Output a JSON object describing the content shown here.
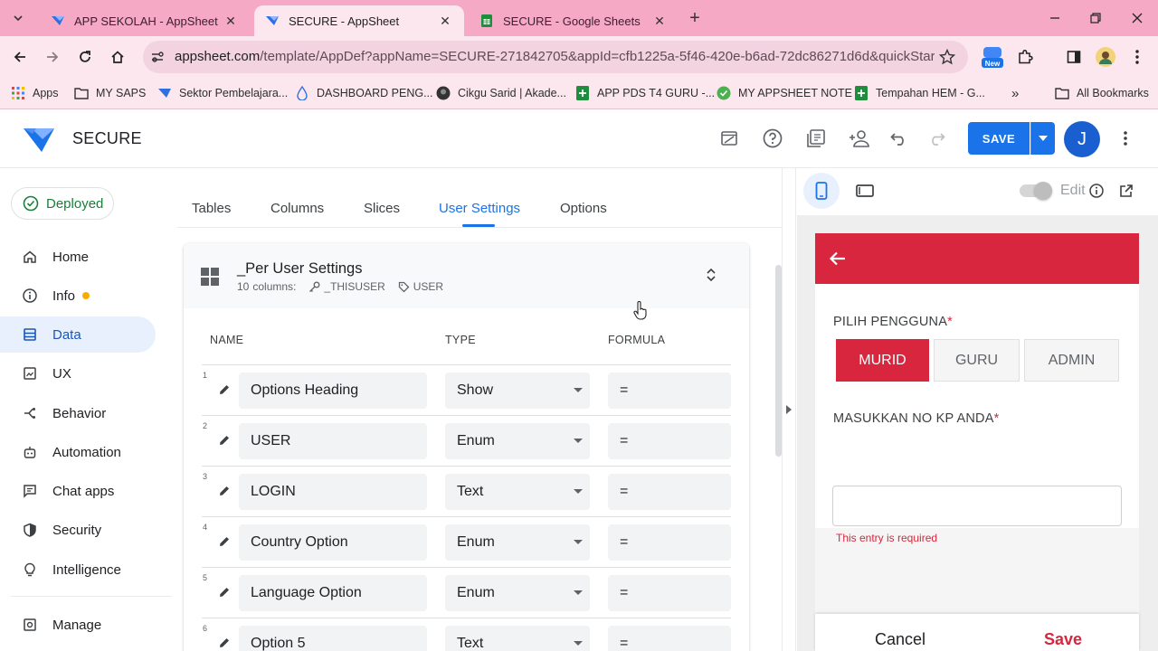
{
  "browser": {
    "tabs": [
      {
        "title": "APP SEKOLAH - AppSheet",
        "icon": "appsheet-icon"
      },
      {
        "title": "SECURE - AppSheet",
        "icon": "appsheet-icon"
      },
      {
        "title": "SECURE - Google Sheets",
        "icon": "google-sheets-icon"
      }
    ],
    "url_domain": "appsheet.com",
    "url_path": "/template/AppDef?appName=SECURE-271842705&appId=cfb1225a-5f46-420e-b6ad-72dc86271d6d&quickStart=False...",
    "new_badge": "New",
    "bookmarks": [
      {
        "label": "Apps",
        "icon": "apps-grid-icon"
      },
      {
        "label": "MY SAPS",
        "icon": "folder-icon"
      },
      {
        "label": "Sektor Pembelajara...",
        "icon": "appsheet-icon"
      },
      {
        "label": "DASHBOARD PENG...",
        "icon": "drop-icon"
      },
      {
        "label": "Cikgu Sarid | Akade...",
        "icon": "avatar-icon"
      },
      {
        "label": "APP PDS T4 GURU -...",
        "icon": "google-sheets-icon"
      },
      {
        "label": "MY APPSHEET NOTE",
        "icon": "check-circle-icon"
      },
      {
        "label": "Tempahan HEM - G...",
        "icon": "google-sheets-icon"
      }
    ],
    "all_bookmarks": "All Bookmarks",
    "more": "»"
  },
  "app": {
    "name": "SECURE",
    "save_label": "SAVE",
    "avatar_letter": "J"
  },
  "sidebar": {
    "status": "Deployed",
    "items": [
      {
        "label": "Home",
        "icon": "home-icon"
      },
      {
        "label": "Info",
        "icon": "info-icon"
      },
      {
        "label": "Data",
        "icon": "data-icon"
      },
      {
        "label": "UX",
        "icon": "ux-icon"
      },
      {
        "label": "Behavior",
        "icon": "behavior-icon"
      },
      {
        "label": "Automation",
        "icon": "automation-icon"
      },
      {
        "label": "Chat apps",
        "icon": "chat-icon"
      },
      {
        "label": "Security",
        "icon": "shield-icon"
      },
      {
        "label": "Intelligence",
        "icon": "bulb-icon"
      }
    ],
    "manage": "Manage"
  },
  "main": {
    "tabs": [
      "Tables",
      "Columns",
      "Slices",
      "User Settings",
      "Options"
    ],
    "active_tab": "User Settings",
    "table": {
      "name": "_Per User Settings",
      "columns_count": "10",
      "columns_word": "columns:",
      "key": "_THISUSER",
      "label": "USER",
      "headers": {
        "name": "NAME",
        "type": "TYPE",
        "formula": "FORMULA"
      },
      "rows": [
        {
          "num": "1",
          "name": "Options Heading",
          "type": "Show",
          "formula": "="
        },
        {
          "num": "2",
          "name": "USER",
          "type": "Enum",
          "formula": "="
        },
        {
          "num": "3",
          "name": "LOGIN",
          "type": "Text",
          "formula": "="
        },
        {
          "num": "4",
          "name": "Country Option",
          "type": "Enum",
          "formula": "="
        },
        {
          "num": "5",
          "name": "Language Option",
          "type": "Enum",
          "formula": "="
        },
        {
          "num": "6",
          "name": "Option 5",
          "type": "Text",
          "formula": "="
        }
      ]
    }
  },
  "preview": {
    "edit_label": "Edit",
    "field1_label": "PILIH PENGGUNA",
    "required_mark": "*",
    "options": [
      "MURID",
      "GURU",
      "ADMIN"
    ],
    "selected_option": "MURID",
    "field2_label": "MASUKKAN NO KP ANDA",
    "field2_value": "",
    "error": "This entry is required",
    "cancel": "Cancel",
    "save": "Save"
  },
  "colors": {
    "accent": "#1a73e8",
    "form_red": "#d7263d",
    "deployed_green": "#188038",
    "tabstrip_pink": "#f6a9c4"
  }
}
